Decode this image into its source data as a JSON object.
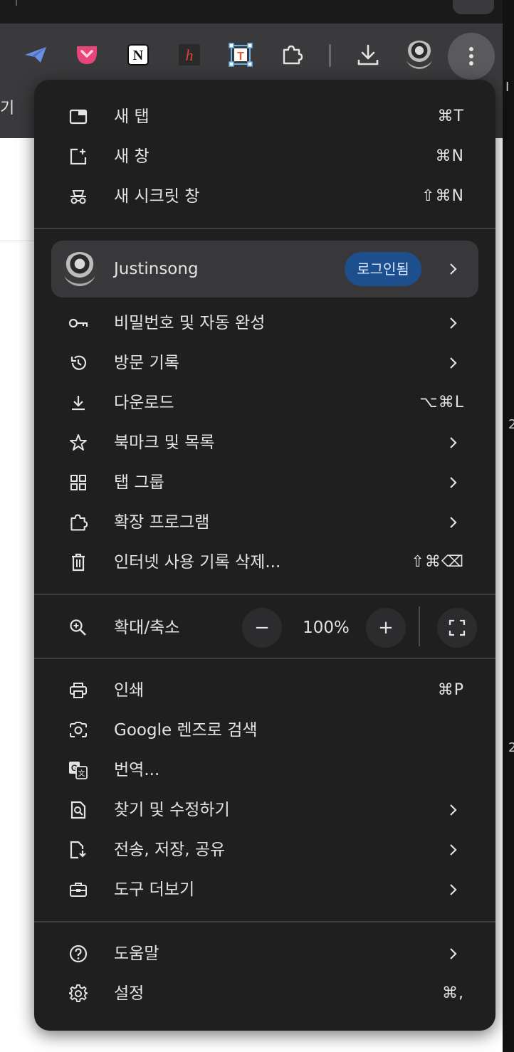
{
  "bookmark_bar": {
    "cut_label": "기"
  },
  "side_fragments": [
    "I",
    "2",
    "2"
  ],
  "toolbar": {
    "icons": [
      "telegram-icon",
      "pocket-icon",
      "notion-icon",
      "hypothesis-icon",
      "text-extension-icon",
      "extensions-icon",
      "download-icon",
      "profile-avatar",
      "more-menu-icon"
    ]
  },
  "menu": {
    "new_tab": {
      "label": "새 탭",
      "shortcut": "⌘T"
    },
    "new_window": {
      "label": "새 창",
      "shortcut": "⌘N"
    },
    "incognito": {
      "label": "새 시크릿 창",
      "shortcut": "⇧⌘N"
    },
    "profile": {
      "name": "Justinsong",
      "badge": "로그인됨"
    },
    "passwords": {
      "label": "비밀번호 및 자동 완성"
    },
    "history": {
      "label": "방문 기록"
    },
    "downloads": {
      "label": "다운로드",
      "shortcut": "⌥⌘L"
    },
    "bookmarks": {
      "label": "북마크 및 목록"
    },
    "tab_groups": {
      "label": "탭 그룹"
    },
    "extensions": {
      "label": "확장 프로그램"
    },
    "clear_data": {
      "label": "인터넷 사용 기록 삭제...",
      "shortcut": "⇧⌘⌫"
    },
    "zoom": {
      "label": "확대/축소",
      "value": "100%",
      "minus": "−",
      "plus": "+"
    },
    "print": {
      "label": "인쇄",
      "shortcut": "⌘P"
    },
    "lens": {
      "label": "Google 렌즈로 검색"
    },
    "translate": {
      "label": "번역..."
    },
    "find_edit": {
      "label": "찾기 및 수정하기"
    },
    "cast_save_share": {
      "label": "전송, 저장, 공유"
    },
    "more_tools": {
      "label": "도구 더보기"
    },
    "help": {
      "label": "도움말"
    },
    "settings": {
      "label": "설정",
      "shortcut": "⌘,"
    }
  }
}
